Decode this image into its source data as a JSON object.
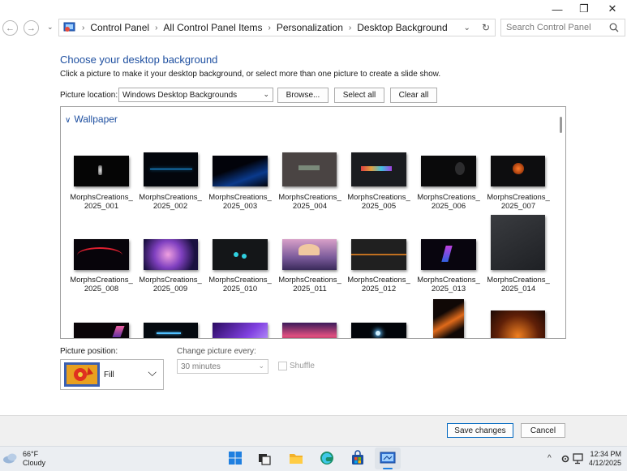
{
  "window": {
    "controls": {
      "minimize": "—",
      "maximize": "❐",
      "close": "✕"
    }
  },
  "address": {
    "crumbs": [
      "Control Panel",
      "All Control Panel Items",
      "Personalization",
      "Desktop Background"
    ],
    "search_placeholder": "Search Control Panel"
  },
  "content": {
    "heading": "Choose your desktop background",
    "subtext": "Click a picture to make it your desktop background, or select more than one picture to create a slide show.",
    "location_label": "Picture location:",
    "location_value": "Windows Desktop Backgrounds",
    "browse_label": "Browse...",
    "select_all_label": "Select all",
    "clear_all_label": "Clear all",
    "group_label": "Wallpaper"
  },
  "wallpapers": [
    {
      "line1": "MorphsCreations_",
      "line2": "2025_001"
    },
    {
      "line1": "MorphsCreations_",
      "line2": "2025_002"
    },
    {
      "line1": "MorphsCreations_",
      "line2": "2025_003"
    },
    {
      "line1": "MorphsCreations_",
      "line2": "2025_004"
    },
    {
      "line1": "MorphsCreations_",
      "line2": "2025_005"
    },
    {
      "line1": "MorphsCreations_",
      "line2": "2025_006"
    },
    {
      "line1": "MorphsCreations_",
      "line2": "2025_007"
    },
    {
      "line1": "MorphsCreations_",
      "line2": "2025_008"
    },
    {
      "line1": "MorphsCreations_",
      "line2": "2025_009"
    },
    {
      "line1": "MorphsCreations_",
      "line2": "2025_010"
    },
    {
      "line1": "MorphsCreations_",
      "line2": "2025_011"
    },
    {
      "line1": "MorphsCreations_",
      "line2": "2025_012"
    },
    {
      "line1": "MorphsCreations_",
      "line2": "2025_013"
    },
    {
      "line1": "MorphsCreations_",
      "line2": "2025_014"
    }
  ],
  "position": {
    "label": "Picture position:",
    "value": "Fill"
  },
  "interval": {
    "label": "Change picture every:",
    "value": "30 minutes"
  },
  "shuffle_label": "Shuffle",
  "footer": {
    "save_label": "Save changes",
    "cancel_label": "Cancel"
  },
  "taskbar": {
    "temperature": "66°F",
    "condition": "Cloudy",
    "time": "12:34 PM",
    "date": "4/12/2025",
    "tray_chevron": "^"
  },
  "colors": {
    "accent": "#1e4fa0",
    "primary_button_border": "#0067c0"
  }
}
